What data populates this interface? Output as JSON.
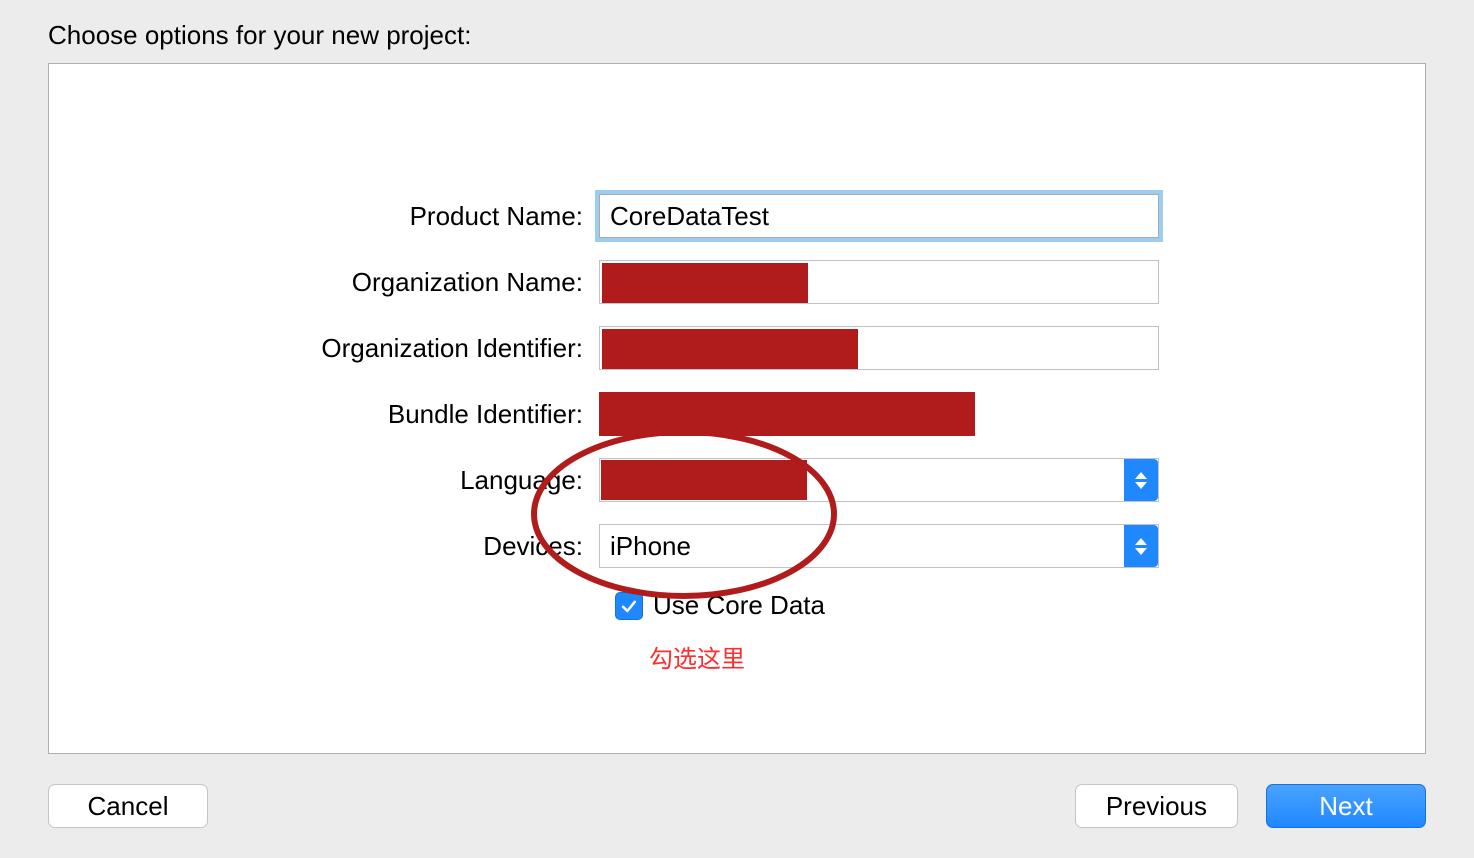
{
  "dialog": {
    "title": "Choose options for your new project:"
  },
  "form": {
    "productName": {
      "label": "Product Name:",
      "value": "CoreDataTest"
    },
    "organizationName": {
      "label": "Organization Name:"
    },
    "organizationIdentifier": {
      "label": "Organization Identifier:"
    },
    "bundleIdentifier": {
      "label": "Bundle Identifier:"
    },
    "language": {
      "label": "Language:"
    },
    "devices": {
      "label": "Devices:",
      "value": "iPhone"
    },
    "useCoreData": {
      "label": "Use Core Data",
      "checked": true
    }
  },
  "annotation": {
    "text": "勾选这里"
  },
  "buttons": {
    "cancel": "Cancel",
    "previous": "Previous",
    "next": "Next"
  }
}
